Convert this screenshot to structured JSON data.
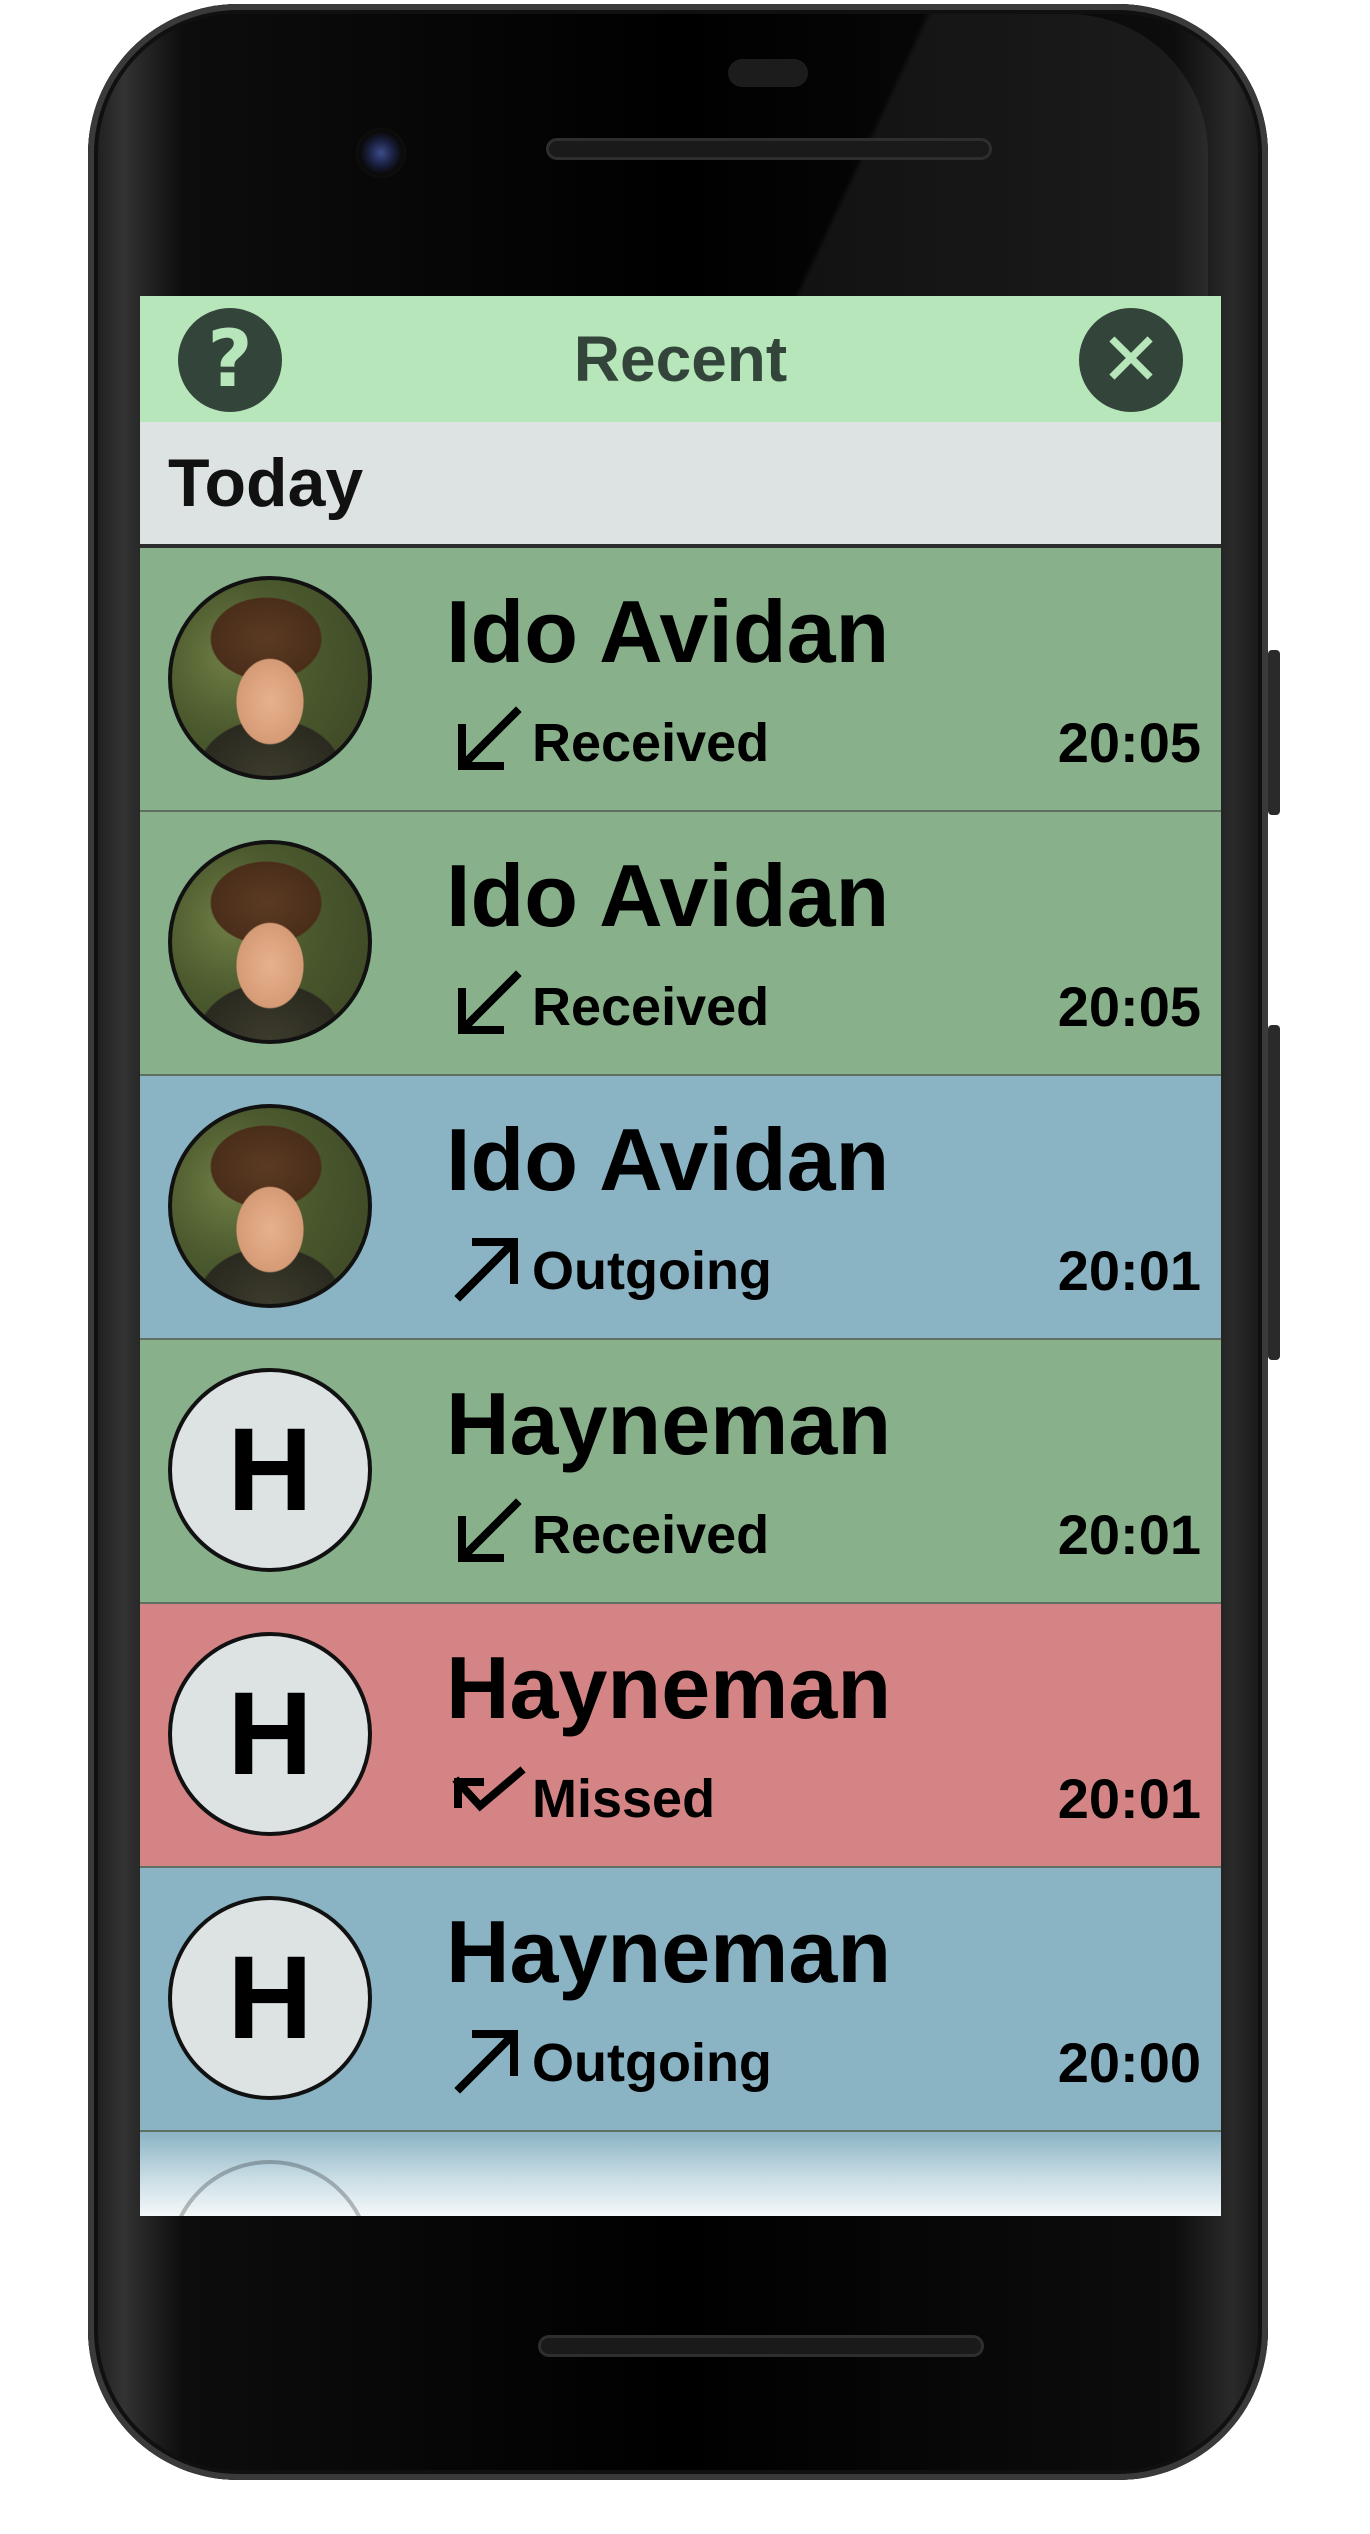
{
  "header": {
    "help_label": "?",
    "title": "Recent",
    "close_label": "✕"
  },
  "section": {
    "title": "Today"
  },
  "colors": {
    "received": "#87b08b",
    "outgoing": "#8ab3c4",
    "missed": "#d48484",
    "header": "#b6e6b9",
    "section": "#dde2e3"
  },
  "calls": [
    {
      "name": "Ido Avidan",
      "type": "Received",
      "time": "20:05",
      "icon": "received-arrow-icon",
      "avatar": "photo",
      "initial": ""
    },
    {
      "name": "Ido Avidan",
      "type": "Received",
      "time": "20:05",
      "icon": "received-arrow-icon",
      "avatar": "photo",
      "initial": ""
    },
    {
      "name": "Ido Avidan",
      "type": "Outgoing",
      "time": "20:01",
      "icon": "outgoing-arrow-icon",
      "avatar": "photo",
      "initial": ""
    },
    {
      "name": "Hayneman",
      "type": "Received",
      "time": "20:01",
      "icon": "received-arrow-icon",
      "avatar": "letter",
      "initial": "H"
    },
    {
      "name": "Hayneman",
      "type": "Missed",
      "time": "20:01",
      "icon": "missed-arrow-icon",
      "avatar": "letter",
      "initial": "H"
    },
    {
      "name": "Hayneman",
      "type": "Outgoing",
      "time": "20:00",
      "icon": "outgoing-arrow-icon",
      "avatar": "letter",
      "initial": "H"
    }
  ]
}
